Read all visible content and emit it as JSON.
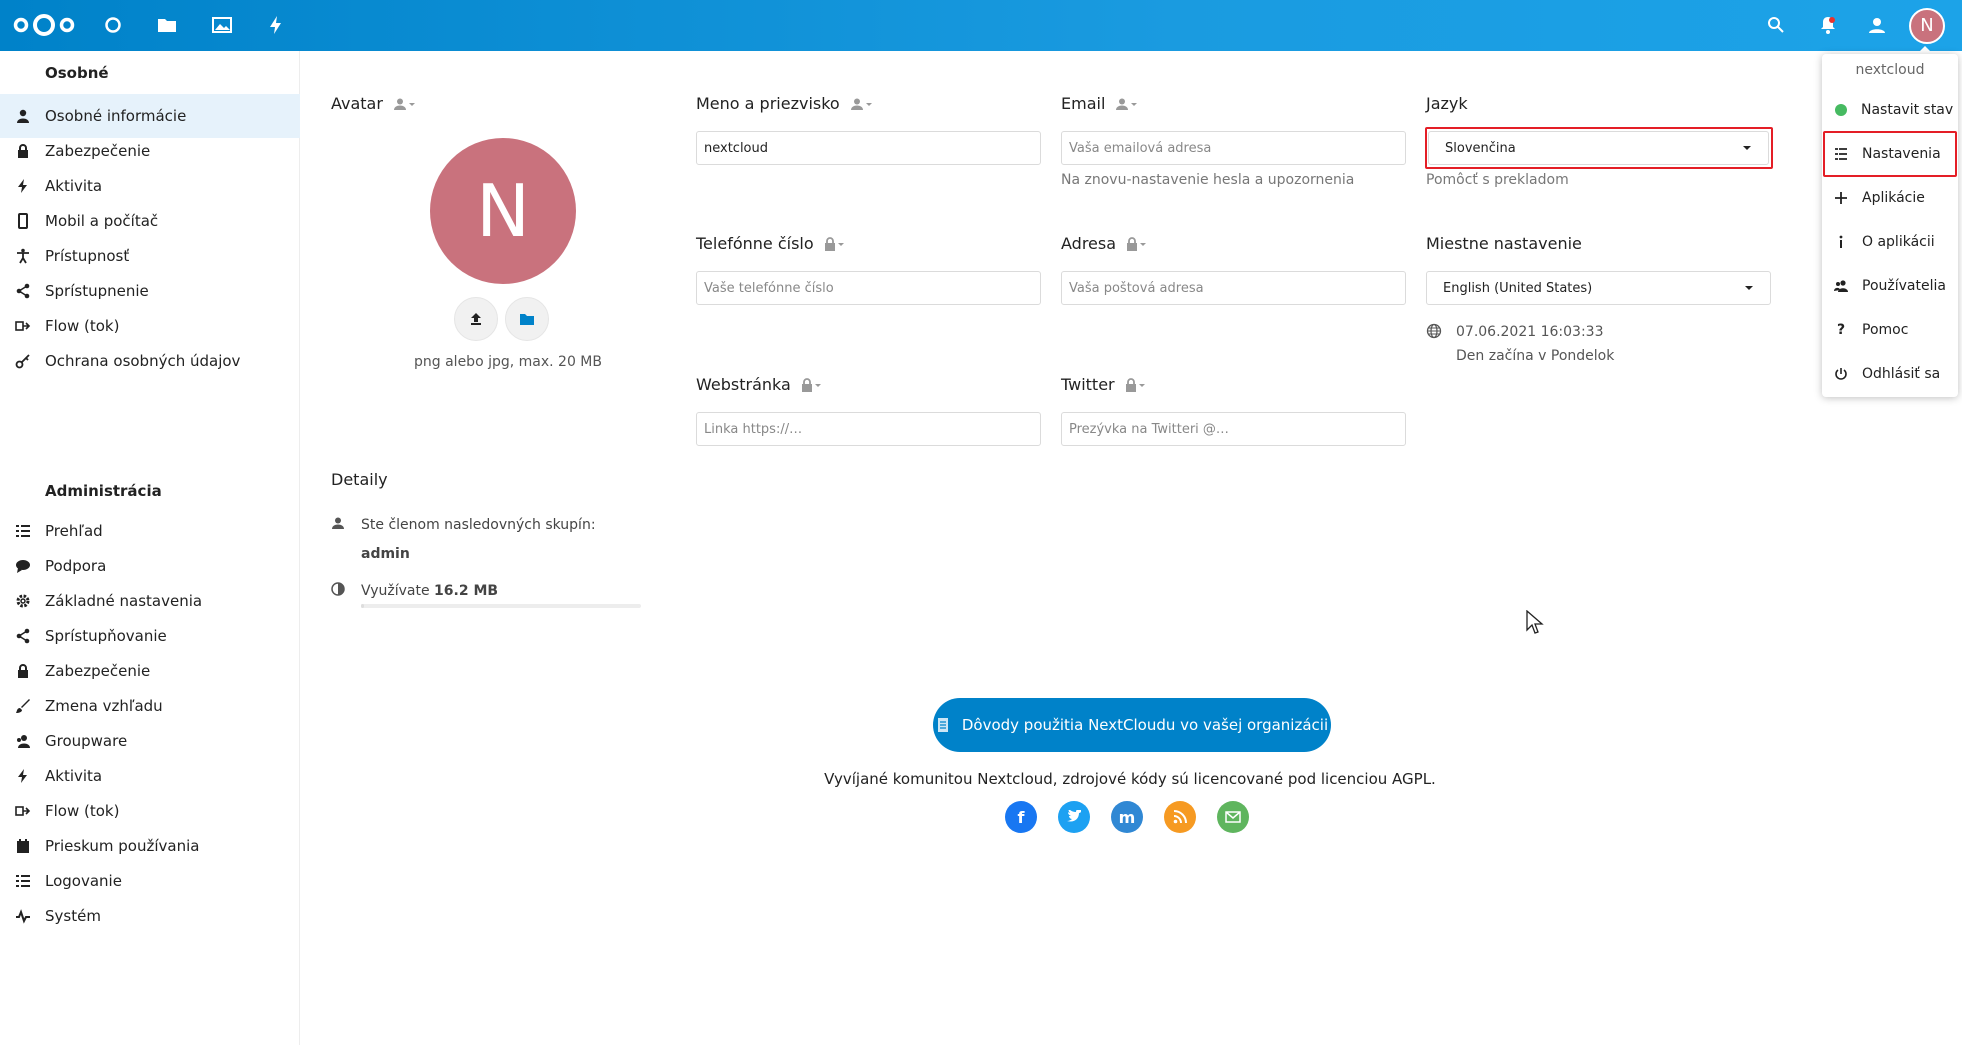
{
  "colors": {
    "brand": "#0082c9",
    "avatar": "#c9727d",
    "highlight": "#e41e26",
    "status_online": "#46ba61"
  },
  "topbar": {
    "apps": [
      {
        "name": "dashboard-icon"
      },
      {
        "name": "files-icon"
      },
      {
        "name": "photos-icon"
      },
      {
        "name": "activity-icon"
      }
    ],
    "avatar_letter": "N"
  },
  "sidebar": {
    "personal_title": "Osobné",
    "personal_items": [
      {
        "label": "Osobné informácie",
        "icon": "user-icon"
      },
      {
        "label": "Zabezpečenie",
        "icon": "lock-icon"
      },
      {
        "label": "Aktivita",
        "icon": "bolt-icon"
      },
      {
        "label": "Mobil a počítač",
        "icon": "phone-icon"
      },
      {
        "label": "Prístupnosť",
        "icon": "accessibility-icon"
      },
      {
        "label": "Sprístupnenie",
        "icon": "share-icon"
      },
      {
        "label": "Flow (tok)",
        "icon": "flow-icon"
      },
      {
        "label": "Ochrana osobných údajov",
        "icon": "key-icon"
      }
    ],
    "admin_title": "Administrácia",
    "admin_items": [
      {
        "label": "Prehľad",
        "icon": "list-icon"
      },
      {
        "label": "Podpora",
        "icon": "chat-icon"
      },
      {
        "label": "Základné nastavenia",
        "icon": "gear-icon"
      },
      {
        "label": "Sprístupňovanie",
        "icon": "share-icon"
      },
      {
        "label": "Zabezpečenie",
        "icon": "lock-icon"
      },
      {
        "label": "Zmena vzhľadu",
        "icon": "brush-icon"
      },
      {
        "label": "Groupware",
        "icon": "group-icon"
      },
      {
        "label": "Aktivita",
        "icon": "bolt-icon"
      },
      {
        "label": "Flow (tok)",
        "icon": "flow-icon"
      },
      {
        "label": "Prieskum používania",
        "icon": "survey-icon"
      },
      {
        "label": "Logovanie",
        "icon": "list-icon"
      },
      {
        "label": "Systém",
        "icon": "pulse-icon"
      }
    ]
  },
  "profile": {
    "avatar_title": "Avatar",
    "avatar_letter": "N",
    "avatar_hint": "png alebo jpg, max. 20 MB",
    "name_title": "Meno a priezvisko",
    "name_value": "nextcloud",
    "email_title": "Email",
    "email_placeholder": "Vaša emailová adresa",
    "email_hint": "Na znovu-nastavenie hesla a upozornenia",
    "lang_title": "Jazyk",
    "lang_value": "Slovenčina",
    "lang_hint": "Pomôcť s prekladom",
    "phone_title": "Telefónne číslo",
    "phone_placeholder": "Vaše telefónne číslo",
    "address_title": "Adresa",
    "address_placeholder": "Vaša poštová adresa",
    "locale_title": "Miestne nastavenie",
    "locale_value": "English (United States)",
    "locale_time": "07.06.2021 16:03:33",
    "locale_week": "Den začína v Pondelok",
    "website_title": "Webstránka",
    "website_placeholder": "Linka https://…",
    "twitter_title": "Twitter",
    "twitter_placeholder": "Prezývka na Twitteri @…",
    "details_title": "Detaily",
    "groups_label": "Ste členom nasledovných skupín:",
    "groups_value": "admin",
    "usage_label": "Využívate",
    "usage_value": "16.2 MB"
  },
  "footer": {
    "cta": "Dôvody použitia NextCloudu vo vašej organizácii",
    "text": "Vyvíjané komunitou Nextcloud, zdrojové kódy sú licencované pod licenciou AGPL."
  },
  "menu": {
    "header": "nextcloud",
    "items": [
      {
        "label": "Nastavit stav",
        "icon": "status-online-icon"
      },
      {
        "label": "Nastavenia",
        "icon": "settings-list-icon"
      },
      {
        "label": "Aplikácie",
        "icon": "plus-icon"
      },
      {
        "label": "O aplikácii",
        "icon": "info-icon"
      },
      {
        "label": "Používatelia",
        "icon": "users-icon"
      },
      {
        "label": "Pomoc",
        "icon": "help-icon"
      },
      {
        "label": "Odhlásiť sa",
        "icon": "power-icon"
      }
    ]
  }
}
